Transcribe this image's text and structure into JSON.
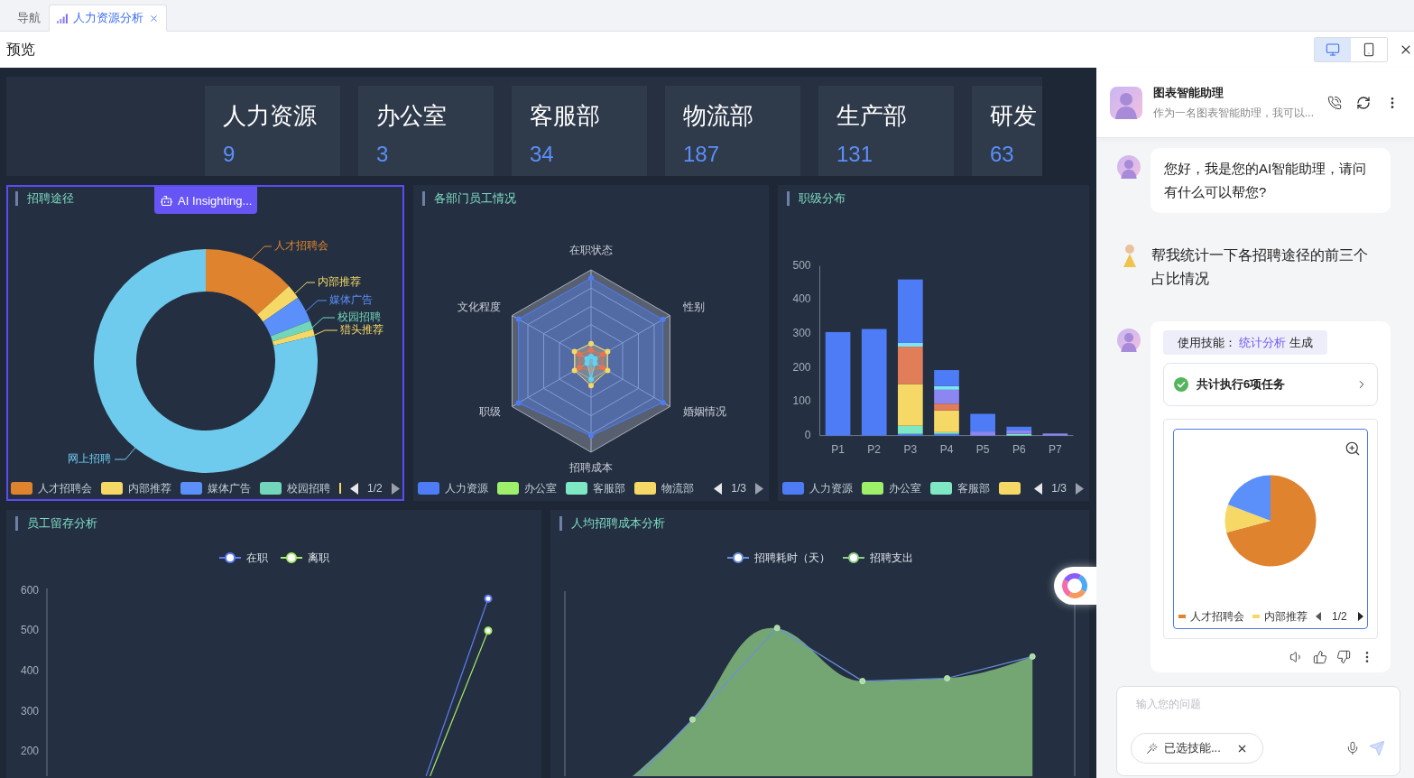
{
  "tabs": [
    {
      "label": "导航",
      "selected": false,
      "closable": false,
      "kind": "plain"
    },
    {
      "label": "人力资源分析",
      "selected": true,
      "closable": true,
      "kind": "chart"
    }
  ],
  "preview": {
    "title": "预览",
    "view_modes": [
      {
        "kind": "desktop",
        "selected": true
      },
      {
        "kind": "mobile",
        "selected": false
      }
    ]
  },
  "kpis": [
    {
      "label": "人力资源",
      "value": "9"
    },
    {
      "label": "办公室",
      "value": "3"
    },
    {
      "label": "客服部",
      "value": "34"
    },
    {
      "label": "物流部",
      "value": "187"
    },
    {
      "label": "生产部",
      "value": "131"
    },
    {
      "label": "研发",
      "value": "63"
    }
  ],
  "charts": [
    {
      "kind": "donut",
      "title": "招聘途径",
      "selected": true,
      "ai_button": "AI Insighting...",
      "slices": [
        {
          "label": "人才招聘会",
          "color": "#e0832e"
        },
        {
          "label": "内部推荐",
          "color": "#f5d865"
        },
        {
          "label": "媒体广告",
          "color": "#5b8ff9"
        },
        {
          "label": "校园招聘",
          "color": "#72d6bb"
        },
        {
          "label": "猎头推荐",
          "color": "#f5d865"
        },
        {
          "label": "网上招聘",
          "color": "#6ecbee"
        }
      ],
      "legend": [
        {
          "label": "人才招聘会",
          "color": "#e0832e"
        },
        {
          "label": "内部推荐",
          "color": "#f5d865"
        },
        {
          "label": "媒体广告",
          "color": "#5b8ff9"
        },
        {
          "label": "校园招聘",
          "color": "#72d6bb"
        }
      ],
      "legend_stub": {
        "color": "#f5d865"
      },
      "pager": "1/2"
    },
    {
      "kind": "radar",
      "title": "各部门员工情况",
      "selected": false,
      "axes": [
        "在职状态",
        "文化程度",
        "性别",
        "职级",
        "婚姻情况",
        "招聘成本"
      ],
      "legend": [
        {
          "label": "人力资源",
          "color": "#4e7cf6"
        },
        {
          "label": "办公室",
          "color": "#9ef06b"
        },
        {
          "label": "客服部",
          "color": "#7ee8c4"
        },
        {
          "label": "物流部",
          "color": "#f5d865"
        }
      ],
      "pager": "1/3"
    },
    {
      "kind": "bar",
      "title": "职级分布",
      "selected": false,
      "chart_data": {
        "type": "bar",
        "stacked": true,
        "categories": [
          "P1",
          "P2",
          "P3",
          "P4",
          "P5",
          "P6",
          "P7"
        ],
        "ylim": [
          0,
          500
        ],
        "yticks": [
          0,
          100,
          200,
          300,
          400,
          500
        ],
        "series": [
          {
            "color": "#4e7cf6",
            "values": [
              0,
              0,
              5,
              5,
              0,
              0,
              0
            ]
          },
          {
            "color": "#7ee8c4",
            "values": [
              0,
              0,
              24,
              5,
              0,
              5,
              0
            ]
          },
          {
            "color": "#f5d865",
            "values": [
              0,
              0,
              123,
              64,
              0,
              0,
              0
            ]
          },
          {
            "color": "#e27d5a",
            "values": [
              0,
              0,
              110,
              20,
              0,
              0,
              0
            ]
          },
          {
            "color": "#8b86f2",
            "values": [
              0,
              0,
              0,
              41,
              12,
              10,
              6
            ]
          },
          {
            "color": "#7de3f5",
            "values": [
              0,
              0,
              11,
              11,
              0,
              0,
              0
            ]
          },
          {
            "color": "#4e7cf6",
            "values": [
              305,
              314,
              187,
              47,
              52,
              11,
              0
            ]
          }
        ]
      },
      "legend": [
        {
          "label": "人力资源",
          "color": "#4e7cf6"
        },
        {
          "label": "办公室",
          "color": "#9ef06b"
        },
        {
          "label": "客服部",
          "color": "#7ee8c4"
        },
        {
          "color": "#f5d865"
        }
      ],
      "pager": "1/3"
    },
    {
      "kind": "line",
      "title": "员工留存分析",
      "selected": false,
      "y_axis": [
        "600",
        "500",
        "400",
        "300",
        "200"
      ],
      "legend": [
        {
          "label": "在职",
          "color": "#5b7cf6"
        },
        {
          "label": "离职",
          "color": "#a6ea6c"
        }
      ]
    },
    {
      "kind": "area",
      "title": "人均招聘成本分析",
      "selected": false,
      "legend": [
        {
          "label": "招聘耗时（天）",
          "color": "#6a8fe0"
        },
        {
          "label": "招聘支出",
          "color": "#8fce86"
        }
      ]
    }
  ],
  "assistant": {
    "name": "图表智能助理",
    "description": "作为一名图表智能助理，我可以..."
  },
  "messages": [
    {
      "kind": "bot",
      "text": "您好，我是您的AI智能助理，请问有什么可以帮您?"
    },
    {
      "kind": "user",
      "text": "帮我统计一下各招聘途径的前三个占比情况"
    },
    {
      "kind": "result",
      "skill": {
        "prefix": "使用技能：",
        "name": "统计分析",
        "suffix": "生成"
      },
      "task_summary": "共计执行6项任务",
      "task_done": true,
      "chart": {
        "slices": [
          {
            "color": "#e0832e"
          },
          {
            "color": "#f5d865"
          },
          {
            "color": "#5b8ff9"
          }
        ],
        "legend": [
          {
            "label": "人才招聘会",
            "color": "#e0832e"
          },
          {
            "label": "内部推荐",
            "color": "#f5d865"
          }
        ],
        "pager": "1/2"
      }
    }
  ],
  "composer": {
    "placeholder": "输入您的问题",
    "skill_chip": "已选技能...",
    "send_disabled": true
  }
}
